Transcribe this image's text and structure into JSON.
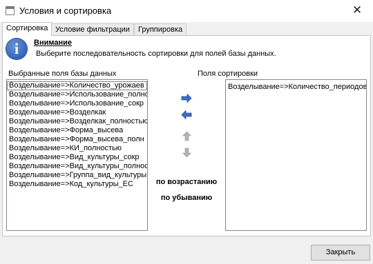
{
  "window": {
    "title": "Условия и сортировка",
    "close_glyph": "✕"
  },
  "tabs": [
    {
      "label": "Сортировка",
      "active": true
    },
    {
      "label": "Условие фильтрации",
      "active": false
    },
    {
      "label": "Группировка",
      "active": false
    }
  ],
  "notice": {
    "icon": "info-icon",
    "icon_glyph": "i",
    "title": "Внимание",
    "text": "Выберите последовательность сортировки для полей базы данных."
  },
  "selected_fields": {
    "label": "Выбранные поля базы данных",
    "items": [
      "Возделывание=>Количество_урожаев",
      "Возделывание=>Использование_полностью",
      "Возделывание=>Использование_сокр",
      "Возделывание=>Возделкак",
      "Возделывание=>Возделкак_полностью",
      "Возделывание=>Форма_высева",
      "Возделывание=>Форма_высева_полн",
      "Возделывание=>КИ_полностью",
      "Возделывание=>Вид_культуры_сокр",
      "Возделывание=>Вид_культуры_полностью",
      "Возделывание=>Группа_вид_культуры",
      "Возделывание=>Код_культуры_ЕС"
    ]
  },
  "sort_fields": {
    "label": "Поля сортировки",
    "items": [
      "Возделывание=>Количество_периодов"
    ]
  },
  "controls": {
    "move_right_icon": "arrow-right-icon",
    "move_left_icon": "arrow-left-icon",
    "move_up_icon": "arrow-up-icon",
    "move_down_icon": "arrow-down-icon",
    "ascending": "по возрастанию",
    "descending": "по убыванию"
  },
  "footer": {
    "close_label": "Закрыть"
  },
  "colors": {
    "arrow_active": "#3a6fc4",
    "arrow_disabled": "#a9a9a9",
    "panel_bg": "#ffffff",
    "window_bg": "#f0f0f0"
  }
}
